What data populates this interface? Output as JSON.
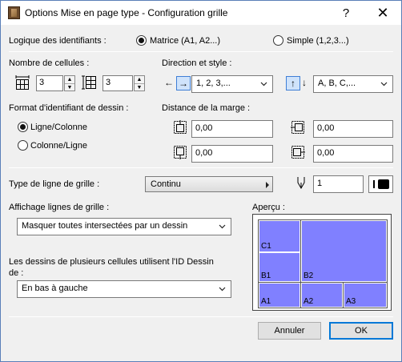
{
  "window": {
    "title": "Options Mise en page type  - Configuration grille",
    "help_label": "?",
    "close_label": "✕"
  },
  "id_logic": {
    "label": "Logique des identifiants :",
    "matrix_label": "Matrice (A1, A2...)",
    "simple_label": "Simple (1,2,3...)",
    "selected": "matrix"
  },
  "cell_count": {
    "label": "Nombre de cellules :",
    "columns_value": "3",
    "rows_value": "3"
  },
  "direction": {
    "label": "Direction et style :",
    "horizontal_left_arrow": "←",
    "horizontal_right_arrow": "→",
    "horizontal_style": "1, 2, 3,...",
    "vertical_up_arrow": "↑",
    "vertical_down_arrow": "↓",
    "vertical_style": "A, B, C,..."
  },
  "id_format": {
    "label": "Format d'identifiant de dessin :",
    "option_row_col": "Ligne/Colonne",
    "option_col_row": "Colonne/Ligne",
    "selected": "row_col"
  },
  "margins": {
    "label": "Distance de la marge :",
    "top": "0,00",
    "left": "0,00",
    "bottom": "0,00",
    "right": "0,00"
  },
  "grid_line": {
    "label": "Type de ligne de grille :",
    "line_type": "Continu",
    "pen_value": "1"
  },
  "grid_display": {
    "label": "Affichage lignes de grille :",
    "value": "Masquer toutes intersectées par un dessin"
  },
  "multi_cell": {
    "label_line1": "Les dessins de plusieurs cellules utilisent l'ID Dessin",
    "label_line2": "de :",
    "value": "En bas à gauche"
  },
  "preview": {
    "label": "Aperçu :",
    "cells": [
      "C1",
      "B1",
      "B2",
      "A1",
      "A2",
      "A3"
    ]
  },
  "buttons": {
    "cancel": "Annuler",
    "ok": "OK"
  },
  "colors": {
    "accent": "#0078d7",
    "preview_cell": "#8080ff"
  }
}
